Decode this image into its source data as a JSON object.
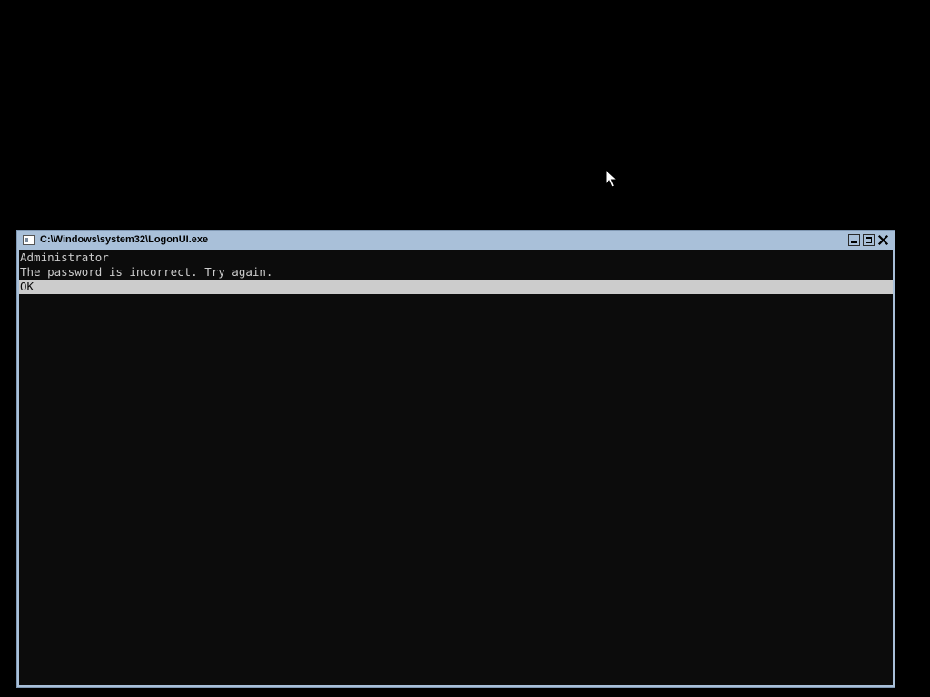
{
  "window": {
    "title": "C:\\Windows\\system32\\LogonUI.exe",
    "icon": "console-app-icon",
    "controls": {
      "minimize": "minimize-icon",
      "maximize": "maximize-icon",
      "close": "close-icon"
    }
  },
  "console": {
    "user": "Administrator",
    "message": "The password is incorrect. Try again.",
    "ok_label": "OK"
  },
  "colors": {
    "desktop_background": "#000000",
    "titlebar": "#a9c0d9",
    "console_background": "#0c0c0c",
    "console_text": "#cccccc",
    "selection_bar": "#cccccc"
  }
}
